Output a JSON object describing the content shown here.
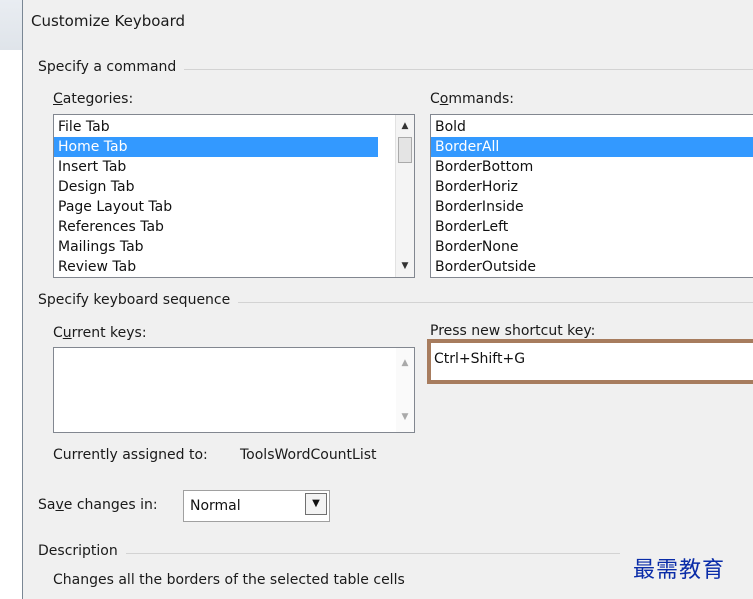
{
  "window": {
    "title": "Customize Keyboard"
  },
  "specify_command": {
    "group_label": "Specify a command",
    "categories": {
      "label_u": "C",
      "label_rest": "ategories:",
      "items": [
        "File Tab",
        "Home Tab",
        "Insert Tab",
        "Design Tab",
        "Page Layout Tab",
        "References Tab",
        "Mailings Tab",
        "Review Tab"
      ],
      "selected": "Home Tab"
    },
    "commands": {
      "label_pre": "C",
      "label_u": "o",
      "label_rest": "mmands:",
      "items": [
        "Bold",
        "BorderAll",
        "BorderBottom",
        "BorderHoriz",
        "BorderInside",
        "BorderLeft",
        "BorderNone",
        "BorderOutside"
      ],
      "selected": "BorderAll"
    }
  },
  "keyboard_sequence": {
    "group_label": "Specify keyboard sequence",
    "current_keys": {
      "label_pre": "C",
      "label_u": "u",
      "label_rest": "rrent keys:",
      "value": ""
    },
    "new_shortcut": {
      "label": "Press new shortcut key:",
      "value": "Ctrl+Shift+G"
    },
    "assigned_label": "Currently assigned to:",
    "assigned_value": "ToolsWordCountList"
  },
  "save_changes": {
    "label_pre": "Sa",
    "label_u": "v",
    "label_rest": "e changes in:",
    "selected": "Normal"
  },
  "description": {
    "group_label": "Description",
    "text": "Changes all the borders of the selected table cells"
  },
  "watermark": {
    "text": "最需教育"
  },
  "colors": {
    "selection": "#3399ff",
    "highlight_border": "#a77c5e",
    "watermark": "#0a2ca8"
  },
  "icons": {
    "scroll_up": "triangle-up",
    "scroll_down": "triangle-down",
    "dropdown": "triangle-down"
  }
}
